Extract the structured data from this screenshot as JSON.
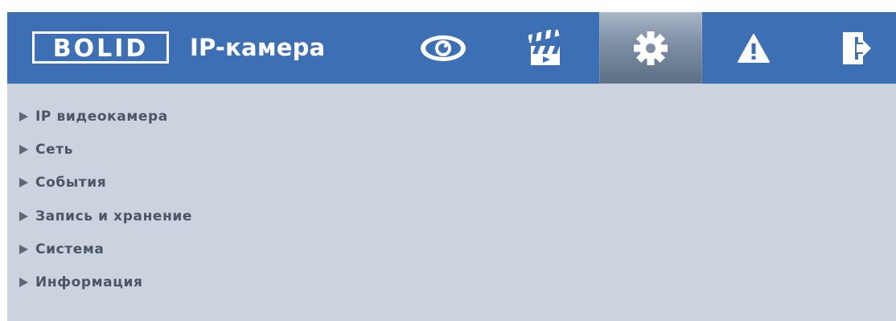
{
  "header": {
    "logo_text": "BOLID",
    "title": "IP-камера",
    "bg_color": "#3d6fb5",
    "nav": [
      {
        "name": "live-view",
        "icon": "eye-icon",
        "active": false
      },
      {
        "name": "playback",
        "icon": "clapperboard-icon",
        "active": false
      },
      {
        "name": "settings",
        "icon": "gear-icon",
        "active": true
      },
      {
        "name": "alarm",
        "icon": "warning-icon",
        "active": false
      },
      {
        "name": "logout",
        "icon": "exit-door-icon",
        "active": false
      }
    ]
  },
  "menu": {
    "items": [
      {
        "label": "IP видеокамера"
      },
      {
        "label": "Сеть"
      },
      {
        "label": "События"
      },
      {
        "label": "Запись и хранение"
      },
      {
        "label": "Система"
      },
      {
        "label": "Информация"
      }
    ]
  },
  "colors": {
    "content_bg": "#cbd3de",
    "menu_text": "#4a5565"
  }
}
